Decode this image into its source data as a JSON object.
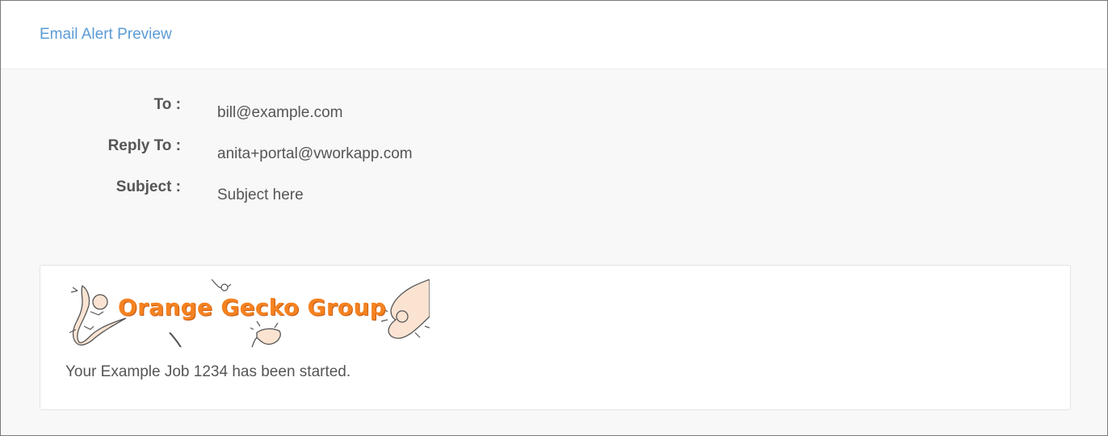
{
  "header": {
    "title": "Email Alert Preview"
  },
  "fields": {
    "to": {
      "label": "To :",
      "value": "bill@example.com"
    },
    "reply_to": {
      "label": "Reply To :",
      "value": "anita+portal@vworkapp.com"
    },
    "subject": {
      "label": "Subject :",
      "value": "Subject here"
    }
  },
  "email": {
    "logo_text": "Orange Gecko Group",
    "body": "Your Example Job 1234 has been started."
  },
  "colors": {
    "link": "#5b9bd5",
    "brand_orange": "#f58220",
    "text": "#555555"
  }
}
